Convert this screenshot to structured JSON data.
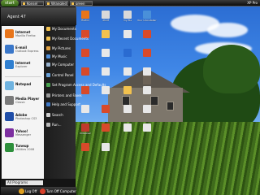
{
  "taskbar": {
    "start_label": "start",
    "tasks": [
      {
        "label": "Konsel"
      },
      {
        "label": "Wrangled"
      },
      {
        "label": "green"
      }
    ],
    "tray_label": "XP Pro"
  },
  "start_menu": {
    "user": "Agent 47",
    "left_items": [
      {
        "title": "Internet",
        "sub": "Mozilla Firefox",
        "icon": "firefox-icon",
        "color": "#e8751a"
      },
      {
        "title": "E-mail",
        "sub": "Outlook Express",
        "icon": "email-icon",
        "color": "#3a77c9"
      },
      {
        "title": "Internet",
        "sub": "Explorer",
        "icon": "ie-icon",
        "color": "#2f7fd0"
      },
      {
        "title": "Notepad",
        "sub": "",
        "icon": "notepad-icon",
        "color": "#6fb3e0"
      },
      {
        "title": "Media Player",
        "sub": "Classic",
        "icon": "media-player-icon",
        "color": "#7a7a7a"
      },
      {
        "title": "Adobe",
        "sub": "Photoshop CS3",
        "icon": "photoshop-icon",
        "color": "#1f4ea8"
      },
      {
        "title": "Yahoo!",
        "sub": "Messenger",
        "icon": "yahoo-icon",
        "color": "#7d2fa0"
      },
      {
        "title": "Tuneup",
        "sub": "Utilities 2008",
        "icon": "tuneup-icon",
        "color": "#2d8f3b"
      }
    ],
    "right_items": [
      {
        "label": "My Documents",
        "icon": "my-documents-icon",
        "color": "#f2c14e"
      },
      {
        "label": "My Recent Documents",
        "icon": "recent-documents-icon",
        "color": "#f2c14e"
      },
      {
        "label": "My Pictures",
        "icon": "my-pictures-icon",
        "color": "#e0a040"
      },
      {
        "label": "My Music",
        "icon": "my-music-icon",
        "color": "#4f8fdc"
      },
      {
        "label": "My Computer",
        "icon": "my-computer-icon",
        "color": "#9ab3cf"
      },
      {
        "label": "Control Panel",
        "icon": "control-panel-icon",
        "color": "#6aa1d8"
      },
      {
        "label": "Set Program Access and Defaults",
        "icon": "program-defaults-icon",
        "color": "#49a24f"
      },
      {
        "label": "Printers and Faxes",
        "icon": "printer-icon",
        "color": "#999"
      },
      {
        "label": "Help and Support",
        "icon": "help-icon",
        "color": "#3f79c8"
      },
      {
        "label": "Search",
        "icon": "search-icon",
        "color": "#d0d0d0"
      },
      {
        "label": "Run...",
        "icon": "run-icon",
        "color": "#bbb"
      }
    ],
    "all_programs": "All Programs",
    "log_off": "Log Off",
    "turn_off": "Turn Off Computer"
  },
  "desktop_icons": [
    {
      "label": "firefox",
      "color": "#e8751a"
    },
    {
      "label": "dfzdf",
      "color": "#d9d9d9"
    },
    {
      "label": "my file",
      "color": "#d9d9d9"
    },
    {
      "label": "Your Uninstaller! 2006",
      "color": "#4a90d9"
    },
    {
      "label": "",
      "color": "#d84a2a"
    },
    {
      "label": "",
      "color": "#f2c14e"
    },
    {
      "label": "",
      "color": "#e8e8e8"
    },
    {
      "label": "",
      "color": "#d84a2a"
    },
    {
      "label": "",
      "color": "#d84a2a"
    },
    {
      "label": "",
      "color": "#e8e8e8"
    },
    {
      "label": "",
      "color": "#2a6bd1"
    },
    {
      "label": "",
      "color": "#d84a2a"
    },
    {
      "label": "",
      "color": "#d84a2a"
    },
    {
      "label": "",
      "color": "#e8e8e8"
    },
    {
      "label": "",
      "color": "#e8e8e8"
    },
    {
      "label": "",
      "color": "#e8e8e8"
    },
    {
      "label": "",
      "color": "#d84a2a"
    },
    {
      "label": "",
      "color": "#e8e8e8"
    },
    {
      "label": "",
      "color": "#f2c14e"
    },
    {
      "label": "",
      "color": "#e8e8e8"
    },
    {
      "label": "",
      "color": "#e8e8e8"
    },
    {
      "label": "",
      "color": "#d84a2a"
    },
    {
      "label": "",
      "color": "#e8e8e8"
    },
    {
      "label": "",
      "color": "#e8e8e8"
    },
    {
      "label": "CCleaner",
      "color": "#c0392b"
    },
    {
      "label": "",
      "color": "#d84a2a"
    },
    {
      "label": "",
      "color": "#e8e8e8"
    },
    {
      "label": "",
      "color": "#e8e8e8"
    },
    {
      "label": "",
      "color": "#d84a2a"
    },
    {
      "label": "",
      "color": "#e8e8e8"
    }
  ]
}
